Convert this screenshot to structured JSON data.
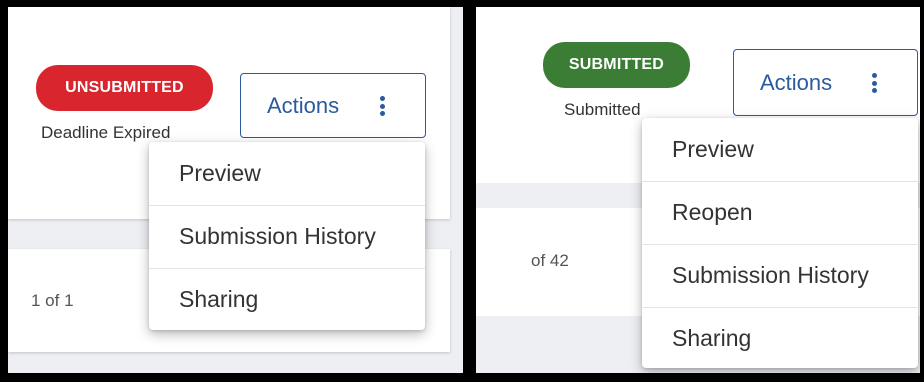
{
  "left": {
    "badge": {
      "label": "UNSUBMITTED",
      "color": "#d9262e"
    },
    "status_text": "Deadline Expired",
    "actions_label": "Actions",
    "pagination_text": "1 of 1",
    "menu": [
      "Preview",
      "Submission History",
      "Sharing"
    ]
  },
  "right": {
    "badge": {
      "label": "SUBMITTED",
      "color": "#3b7d35"
    },
    "status_text": "Submitted",
    "actions_label": "Actions",
    "pagination_text": "of 42",
    "menu": [
      "Preview",
      "Reopen",
      "Submission History",
      "Sharing"
    ]
  },
  "icons": {
    "actions": "kebab-vertical-icon"
  },
  "colors": {
    "primary": "#2a5b9c"
  }
}
